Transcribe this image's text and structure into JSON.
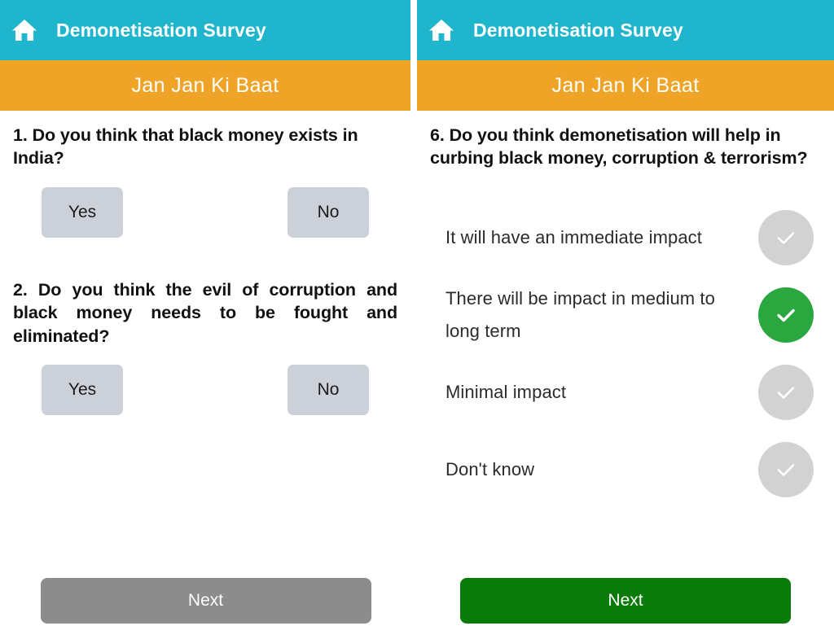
{
  "theme": {
    "header_teal": "#1fb6cd",
    "header_orange": "#efa427",
    "answer_button_grey": "#ccd1d9",
    "check_selected_green": "#2aa73f",
    "check_unselected_grey": "#d2d2d2",
    "next_disabled_grey": "#8c8c8c",
    "next_enabled_green": "#0a7a0a",
    "page_background": "#ffffff"
  },
  "left_panel": {
    "header": {
      "home_icon": "home-icon",
      "title": "Demonetisation Survey",
      "subtitle": "Jan Jan Ki Baat"
    },
    "questions": [
      {
        "number": "1.",
        "text": "1. Do you think that black money exists in India?",
        "answers": [
          {
            "label": "Yes",
            "selected": false
          },
          {
            "label": "No",
            "selected": false
          }
        ]
      },
      {
        "number": "2.",
        "text": "2. Do you think the evil of corruption and black money needs to be fought and eliminated?",
        "answers": [
          {
            "label": "Yes",
            "selected": false
          },
          {
            "label": "No",
            "selected": false
          }
        ]
      }
    ],
    "next_button": {
      "label": "Next",
      "enabled": false
    }
  },
  "right_panel": {
    "header": {
      "home_icon": "home-icon",
      "title": "Demonetisation Survey",
      "subtitle": "Jan Jan Ki Baat"
    },
    "question": {
      "number": "6.",
      "text": "6. Do you think demonetisation will help in curbing black money, corruption & terrorism?"
    },
    "options": [
      {
        "label": "It will have an immediate impact",
        "selected": false,
        "icon": "check-icon"
      },
      {
        "label": "There will be impact in medium to long term",
        "selected": true,
        "icon": "check-icon"
      },
      {
        "label": "Minimal impact",
        "selected": false,
        "icon": "check-icon"
      },
      {
        "label": "Don't know",
        "selected": false,
        "icon": "check-icon"
      }
    ],
    "next_button": {
      "label": "Next",
      "enabled": true
    }
  }
}
